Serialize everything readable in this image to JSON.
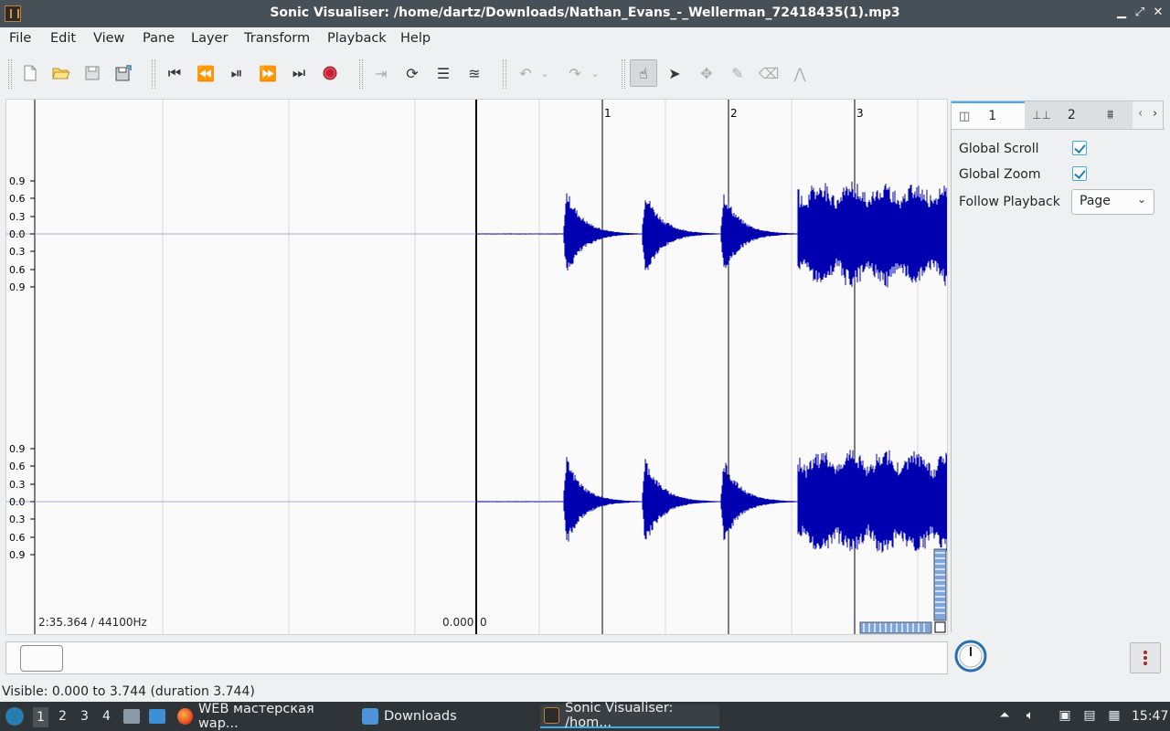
{
  "window": {
    "title": "Sonic Visualiser: /home/dartz/Downloads/Nathan_Evans_-_Wellerman_72418435(1).mp3",
    "controls": [
      "minimize-icon",
      "maximize-icon",
      "close-icon"
    ]
  },
  "menu": [
    "File",
    "Edit",
    "View",
    "Pane",
    "Layer",
    "Transform",
    "Playback",
    "Help"
  ],
  "toolbar": {
    "file_icons": [
      "new-file-icon",
      "open-file-icon",
      "save-file-icon",
      "save-as-icon"
    ],
    "transport_icons": [
      "rewind-start-icon",
      "rewind-icon",
      "play-pause-icon",
      "fast-forward-icon",
      "fast-forward-end-icon",
      "record-icon"
    ],
    "loop_icons": [
      "play-selection-icon",
      "loop-icon",
      "solo-icon",
      "normalize-icon"
    ],
    "edit_icons": [
      "undo-icon",
      "redo-icon"
    ],
    "mode_icons": [
      "navigate-icon",
      "select-icon",
      "move-icon",
      "draw-icon",
      "erase-icon",
      "measure-icon"
    ]
  },
  "pane": {
    "scale_top": [
      "0.9",
      "0.6",
      "0.3",
      "0.0",
      "0.3",
      "0.6",
      "0.9"
    ],
    "scale_bottom": [
      "0.9",
      "0.6",
      "0.3",
      "0.0",
      "0.3",
      "0.6",
      "0.9"
    ],
    "ruler_labels": [
      "1",
      "2",
      "3"
    ],
    "position_readout": "2:35.364 / 44100Hz",
    "cursor_time": "0.000",
    "cursor_frame": "0",
    "waveform_color": "#0000b0"
  },
  "properties": {
    "tabs": [
      {
        "icon": "pane-icon",
        "label": "1"
      },
      {
        "icon": "ruler-icon",
        "label": "2"
      },
      {
        "icon": "waveform-icon",
        "label": ""
      }
    ],
    "global_scroll_label": "Global Scroll",
    "global_scroll": true,
    "global_zoom_label": "Global Zoom",
    "global_zoom": true,
    "follow_playback_label": "Follow Playback",
    "follow_playback_value": "Page"
  },
  "status": {
    "visible": "Visible: 0.000 to 3.744 (duration 3.744)"
  },
  "taskbar": {
    "workspaces": [
      "1",
      "2",
      "3",
      "4"
    ],
    "tasks": [
      {
        "label": "WEB мастерская wap...",
        "icon": "firefox-icon"
      },
      {
        "label": "Downloads",
        "icon": "folder-icon"
      },
      {
        "label": "Sonic Visualiser: /hom...",
        "icon": "sonic-visualiser-icon"
      }
    ],
    "clock": "15:47",
    "accent": "#3daee9"
  }
}
